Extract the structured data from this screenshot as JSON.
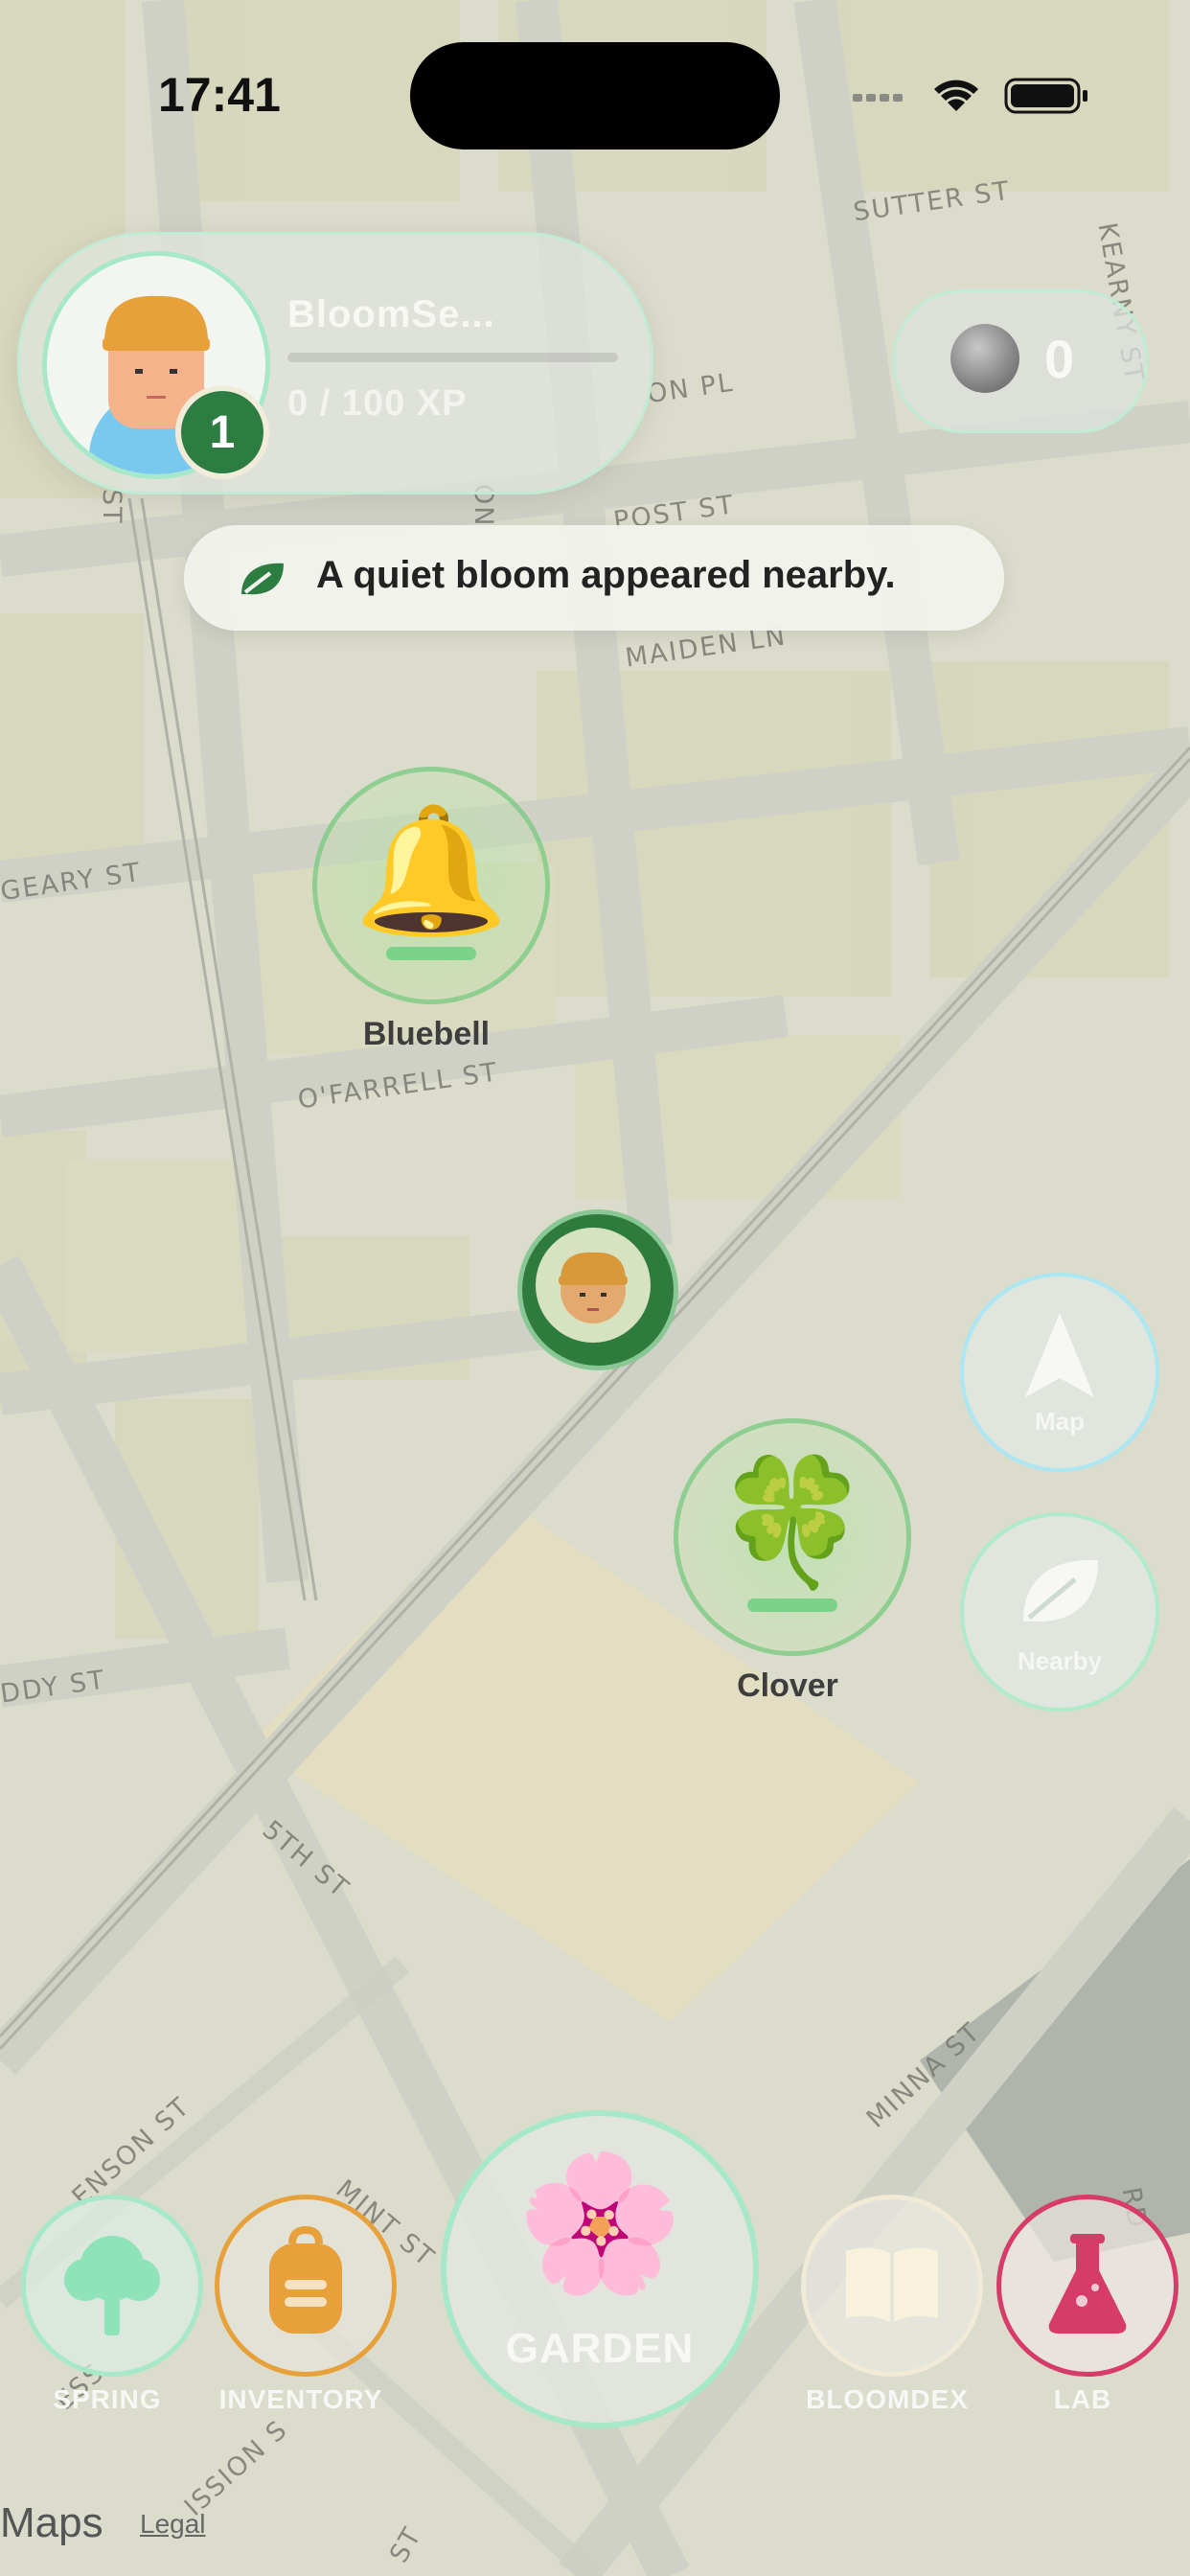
{
  "status_bar": {
    "time": "17:41"
  },
  "player": {
    "name": "BloomSe...",
    "level": "1",
    "xp_text": "0 / 100 XP",
    "xp_progress": 0
  },
  "currency": {
    "coins": "0"
  },
  "toast": {
    "message": "A quiet bloom appeared nearby."
  },
  "map": {
    "streets": [
      "SUTTER ST",
      "KEARNY ST",
      "ON PL",
      "POST ST",
      "MAIDEN LN",
      "GEARY ST",
      "O'FARRELL ST",
      "DDY ST",
      "5TH ST",
      "MINNA ST",
      "ENSON ST",
      "MINT ST",
      "ISSION S",
      "ST",
      "ESS",
      "RD",
      "ON",
      "ST"
    ],
    "flowers": [
      {
        "name": "Bluebell",
        "icon": "bell-icon"
      },
      {
        "name": "Clover",
        "icon": "four-leaf-clover-icon"
      }
    ]
  },
  "side_buttons": {
    "map": "Map",
    "nearby": "Nearby"
  },
  "bottom_nav": {
    "spring": "SPRING",
    "inventory": "INVENTORY",
    "garden": "GARDEN",
    "bloomdex": "BLOOMDEX",
    "lab": "LAB"
  },
  "footer": {
    "maps": "Maps",
    "legal": "Legal"
  },
  "colors": {
    "accent_green": "#2d7d43",
    "inventory_orange": "#e8a03a",
    "lab_pink": "#d63b6a",
    "mint": "#a6e8c8"
  }
}
